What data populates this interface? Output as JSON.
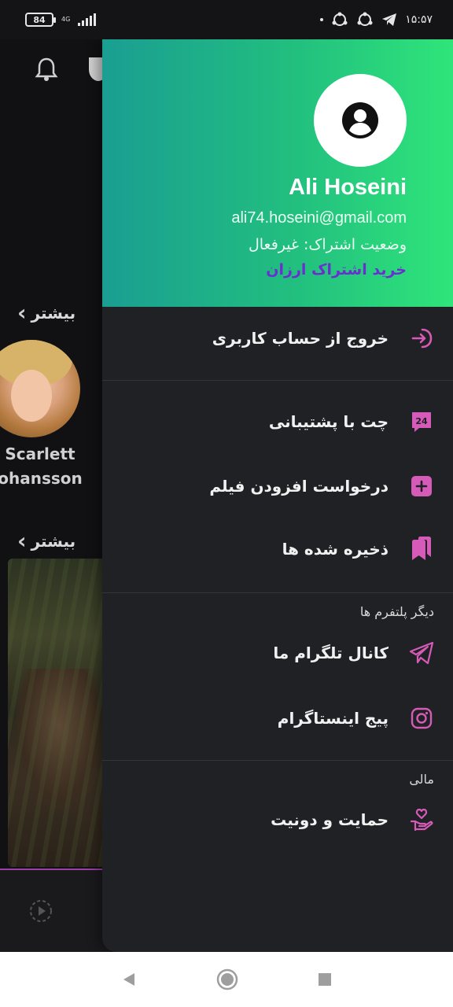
{
  "status_bar": {
    "battery": "84",
    "network": "4G",
    "time": "۱۵:۵۷"
  },
  "background": {
    "more_label_1": "بیشتر",
    "more_label_2": "بیشتر",
    "celebrity_name_line1": "Scarlett",
    "celebrity_name_line2": "ohansson"
  },
  "drawer": {
    "user": {
      "name": "Ali Hoseini",
      "email": "ali74.hoseini@gmail.com",
      "subscription_status": "وضعیت اشتراک: غیرفعال",
      "buy_link": "خرید اشتراک ارزان"
    },
    "menu": {
      "logout": "خروج از حساب کاربری",
      "support_chat": "چت با پشتیبانی",
      "request_movie": "درخواست افزودن فیلم",
      "saved": "ذخیره شده ها"
    },
    "sections": {
      "other_platforms": "دیگر پلتفرم ها",
      "financial": "مالی"
    },
    "platforms": {
      "telegram": "کانال تلگرام ما",
      "instagram": "پیج اینستاگرام"
    },
    "financial": {
      "donate": "حمایت و دونیت"
    },
    "support_badge": "24"
  },
  "colors": {
    "accent": "#d65bb8",
    "header_start": "#1a9e92",
    "header_end": "#2fe57a",
    "link": "#6a2fd0",
    "drawer_bg": "#202124"
  }
}
